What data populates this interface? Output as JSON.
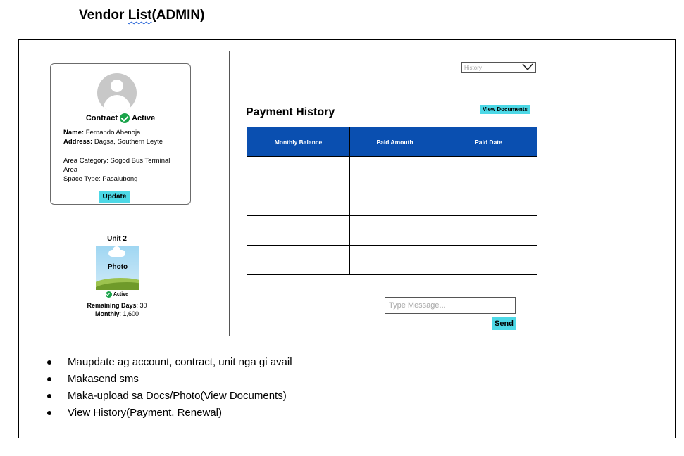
{
  "page_title": {
    "prefix": "Vendor ",
    "underlined": "List",
    "suffix": "(ADMIN)"
  },
  "profile": {
    "contract_label": "Contract",
    "contract_status": "Active",
    "name_label": "Name:",
    "name_value": "Fernando Abenoja",
    "address_label": "Address:",
    "address_value": "Dagsa, Southern Leyte",
    "area_category": "Area Category: Sogod Bus Terminal Area",
    "space_type": "Space Type: Pasalubong",
    "update_label": "Update"
  },
  "unit": {
    "title": "Unit 2",
    "photo_label": "Photo",
    "status": "Active",
    "remaining_label": "Remaining Days",
    "remaining_value": ": 30",
    "monthly_label": "Monthly",
    "monthly_value": ":  1,600"
  },
  "history_select": {
    "selected": "History"
  },
  "payment": {
    "title": "Payment History",
    "view_documents_label": "View Documents",
    "columns": [
      "Monthly Balance",
      "Paid Amouth",
      "Paid Date"
    ]
  },
  "message": {
    "placeholder": "Type Message...",
    "send_label": "Send"
  },
  "notes": [
    "Maupdate ag account, contract, unit nga gi avail",
    "Makasend sms",
    "Maka-upload sa Docs/Photo(View Documents)",
    "View History(Payment, Renewal)"
  ],
  "colors": {
    "accent_cyan": "#4dd8e6",
    "table_header": "#0a4fb0",
    "active_green": "#1aa34a"
  }
}
